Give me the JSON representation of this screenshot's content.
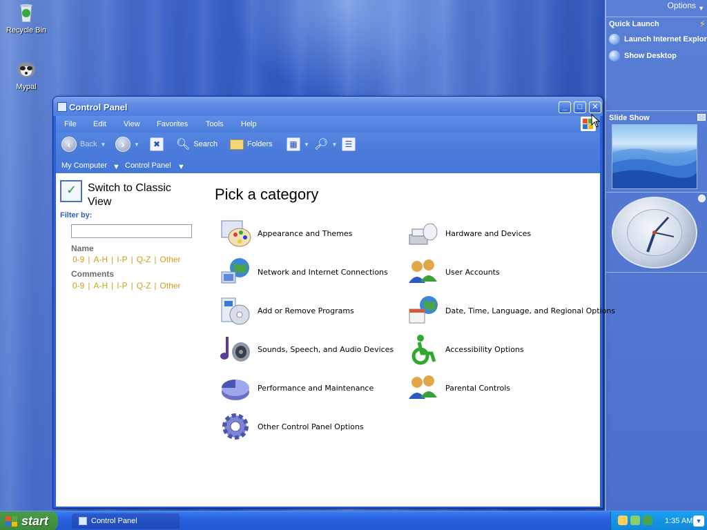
{
  "desktop": {
    "icons": [
      {
        "label": "Recycle Bin",
        "icon": "recycle-bin-icon"
      },
      {
        "label": "Mypal",
        "icon": "mypal-icon"
      }
    ]
  },
  "sidebar": {
    "options_label": "Options",
    "quick_launch": {
      "title": "Quick Launch",
      "items": [
        {
          "label": "Launch Internet Explorer",
          "icon": "ie-icon"
        },
        {
          "label": "Show Desktop",
          "icon": "desktop-icon"
        }
      ]
    },
    "slideshow_title": "Slide Show"
  },
  "window": {
    "title": "Control Panel",
    "menu": [
      "File",
      "Edit",
      "View",
      "Favorites",
      "Tools",
      "Help"
    ],
    "toolbar": {
      "back_label": "Back",
      "search_label": "Search",
      "folders_label": "Folders"
    },
    "address": {
      "crumbs": [
        "My Computer",
        "Control Panel"
      ]
    },
    "left_pane": {
      "switch_label": "Switch to Classic View",
      "filter_label": "Filter by:",
      "filter_value": "",
      "groups": [
        {
          "label": "Name",
          "links": [
            "0-9",
            "A-H",
            "I-P",
            "Q-Z",
            "Other"
          ]
        },
        {
          "label": "Comments",
          "links": [
            "0-9",
            "A-H",
            "I-P",
            "Q-Z",
            "Other"
          ]
        }
      ]
    },
    "main": {
      "heading": "Pick a category",
      "categories_left": [
        {
          "label": "Appearance and Themes",
          "icon": "appearance-themes-icon"
        },
        {
          "label": "Network and Internet Connections",
          "icon": "network-icon"
        },
        {
          "label": "Add or Remove Programs",
          "icon": "add-remove-programs-icon"
        },
        {
          "label": "Sounds, Speech, and Audio Devices",
          "icon": "sounds-icon"
        },
        {
          "label": "Performance and Maintenance",
          "icon": "performance-icon"
        },
        {
          "label": "Other Control Panel Options",
          "icon": "gear-icon"
        }
      ],
      "categories_right": [
        {
          "label": "Hardware and Devices",
          "icon": "hardware-icon"
        },
        {
          "label": "User Accounts",
          "icon": "user-accounts-icon"
        },
        {
          "label": "Date, Time, Language, and Regional Options",
          "icon": "date-time-icon"
        },
        {
          "label": "Accessibility Options",
          "icon": "accessibility-icon"
        },
        {
          "label": "Parental Controls",
          "icon": "parental-controls-icon"
        }
      ]
    }
  },
  "taskbar": {
    "start_label": "start",
    "task_label": "Control Panel",
    "clock": "1:35 AM"
  },
  "colors": {
    "accent": "#2a5fd8",
    "link_gold": "#d39b1c",
    "filter_blue": "#2f5fb6"
  }
}
